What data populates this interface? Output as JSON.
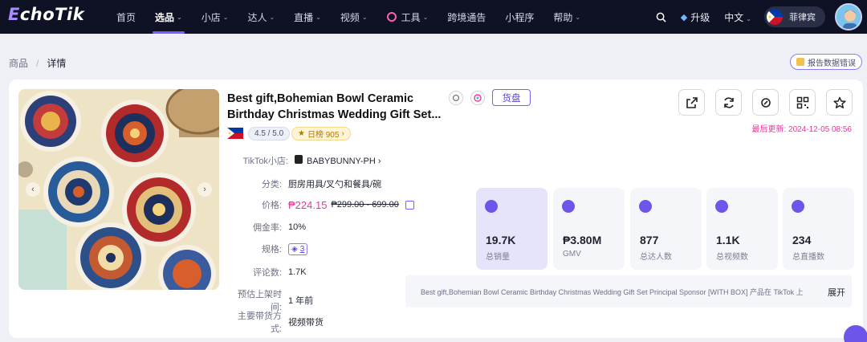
{
  "nav": {
    "logo_e": "E",
    "logo_rest": "choTik",
    "items": [
      {
        "label": "首页",
        "has_dropdown": false,
        "active": false
      },
      {
        "label": "选品",
        "has_dropdown": true,
        "active": true
      },
      {
        "label": "小店",
        "has_dropdown": true,
        "active": false
      },
      {
        "label": "达人",
        "has_dropdown": true,
        "active": false
      },
      {
        "label": "直播",
        "has_dropdown": true,
        "active": false
      },
      {
        "label": "视频",
        "has_dropdown": true,
        "active": false
      },
      {
        "label": "工具",
        "has_dropdown": true,
        "active": false
      },
      {
        "label": "跨境通告",
        "has_dropdown": false,
        "active": false
      },
      {
        "label": "小程序",
        "has_dropdown": false,
        "active": false
      },
      {
        "label": "帮助",
        "has_dropdown": true,
        "active": false
      }
    ],
    "upgrade": "升级",
    "language": "中文",
    "country": "菲律宾",
    "accent_color": "#7b5cff"
  },
  "breadcrumb": {
    "parent": "商品",
    "separator": "/",
    "current": "详情"
  },
  "report_button": "报告数据错误",
  "product": {
    "title": "Best gift,Bohemian Bowl Ceramic Birthday Christmas Wedding Gift Set...",
    "huopan_label": "货盘",
    "rating": "4.5 / 5.0",
    "rank": "日榜 905",
    "shop_label": "TikTok小店:",
    "shop_name": "BABYBUNNY-PH",
    "category_label": "分类:",
    "category": "厨房用具/叉勺和餐具/碗",
    "price_label": "价格:",
    "price": "₱224.15",
    "price_original": "₱299.00 - 699.00",
    "commission_label": "佣金率:",
    "commission": "10%",
    "spec_label": "规格:",
    "spec_count": "3",
    "reviews_label": "评论数:",
    "reviews": "1.7K",
    "listed_label": "预估上架时间:",
    "listed": "1 年前",
    "channel_label": "主要带货方式:",
    "channel": "视频带货",
    "updated": "最后更新: 2024-12-05 08:56"
  },
  "stats": [
    {
      "value": "19.7K",
      "label": "总销量",
      "icon": "thumbs-up-icon"
    },
    {
      "value": "₱3.80M",
      "label": "GMV",
      "icon": "wallet-icon"
    },
    {
      "value": "877",
      "label": "总达人数",
      "icon": "creator-icon"
    },
    {
      "value": "1.1K",
      "label": "总视频数",
      "icon": "video-icon"
    },
    {
      "value": "234",
      "label": "总直播数",
      "icon": "live-icon"
    }
  ],
  "description": {
    "text": "Best gift,Bohemian Bowl Ceramic Birthday Christmas Wedding Gift Set Principal Sponsor [WITH BOX] 产品在 TikTok 上",
    "expand": "展开"
  }
}
